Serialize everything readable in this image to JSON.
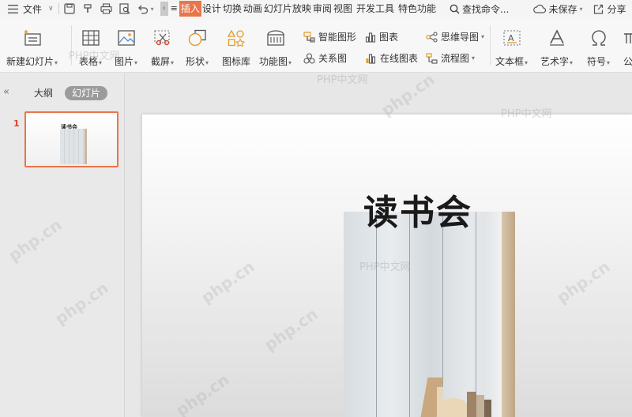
{
  "menubar": {
    "file_label": "文件",
    "tabs": [
      {
        "label": "插入",
        "active": true
      },
      {
        "label": "设计"
      },
      {
        "label": "切换"
      },
      {
        "label": "动画"
      },
      {
        "label": "幻灯片放映"
      },
      {
        "label": "审阅"
      },
      {
        "label": "视图"
      },
      {
        "label": "开发工具"
      },
      {
        "label": "特色功能"
      }
    ],
    "search_label": "查找命令...",
    "unsaved_label": "未保存",
    "share_label": "分享"
  },
  "ribbon": {
    "new_slide": "新建幻灯片",
    "table": "表格",
    "picture": "图片",
    "screenshot": "截屏",
    "shape": "形状",
    "icon_library": "图标库",
    "function_chart": "功能图",
    "smart_graphic": "智能图形",
    "chart": "图表",
    "relation_chart": "关系图",
    "online_chart": "在线图表",
    "mind_map": "思维导图",
    "flowchart": "流程图",
    "text_box": "文本框",
    "word_art": "艺术字",
    "symbol": "符号",
    "formula": "公"
  },
  "leftpanel": {
    "tab_outline": "大纲",
    "tab_slides": "幻灯片",
    "slide_number": "1",
    "thumb_title": "读书会"
  },
  "slide": {
    "title": "读书会"
  },
  "watermark": {
    "text": "PHP中文网",
    "site": "php.cn"
  },
  "colors": {
    "accent": "#e9754a",
    "slide_number": "#d9472b",
    "ribbon_bg": "#f7f7f7",
    "canvas_bg": "#e7e7e7"
  }
}
